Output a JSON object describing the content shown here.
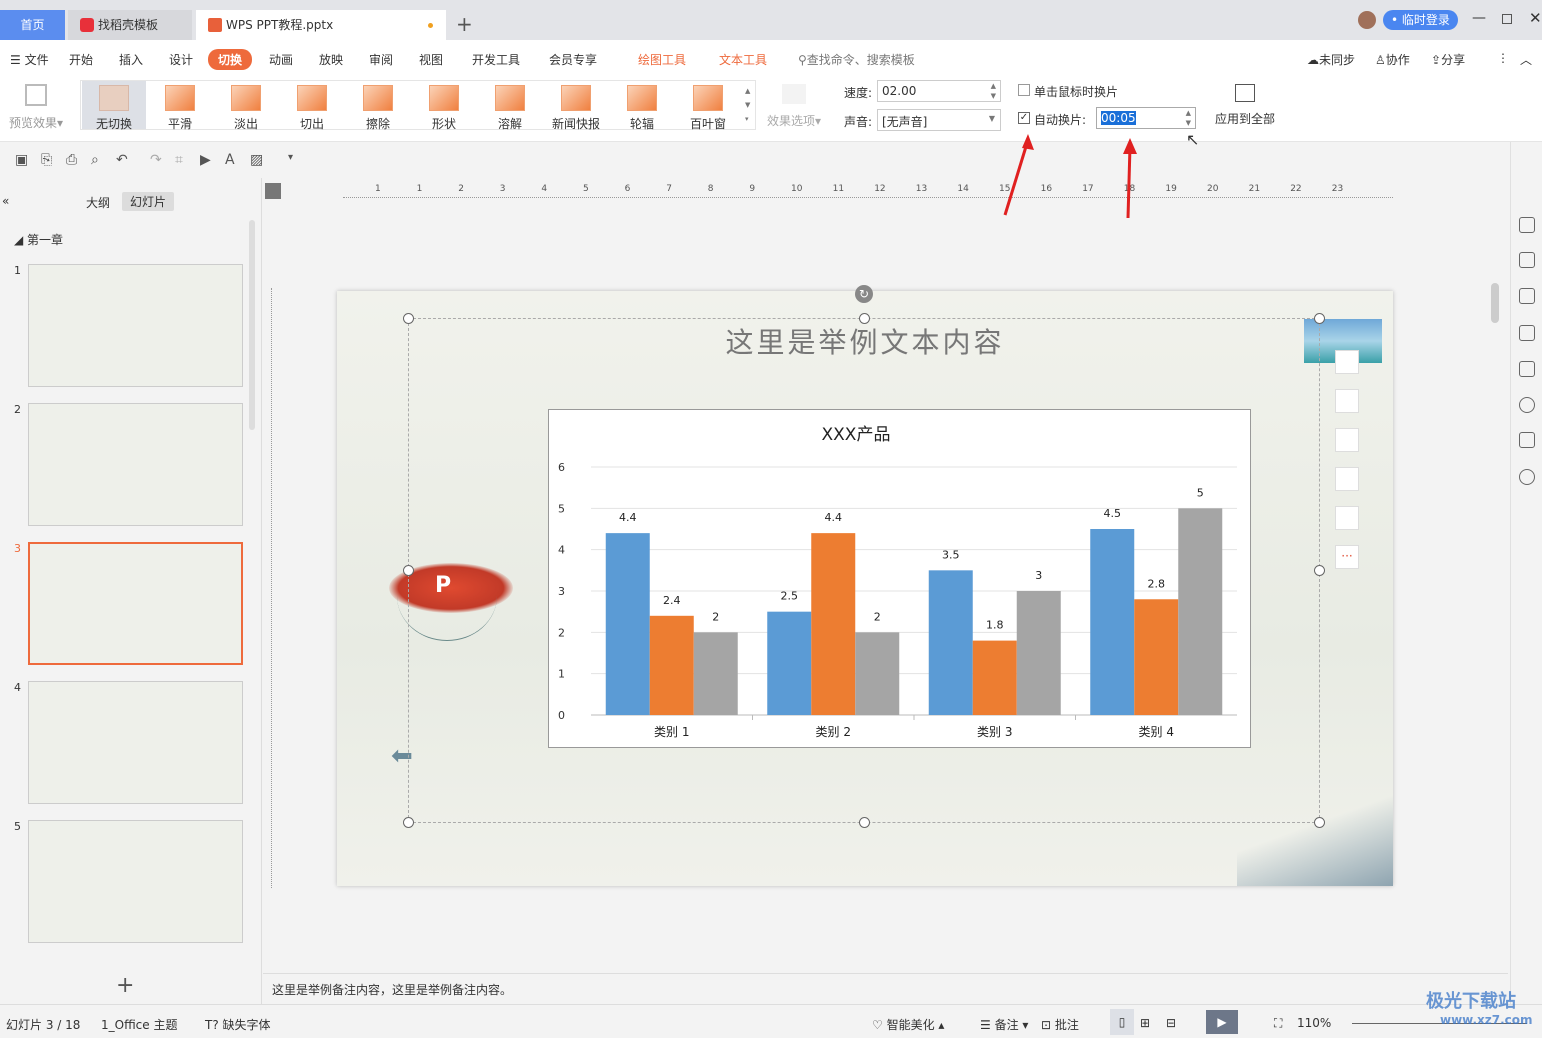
{
  "tabs": [
    {
      "label": "首页"
    },
    {
      "label": "找稻壳模板"
    },
    {
      "label": "WPS PPT教程.pptx"
    }
  ],
  "window": {
    "login": "• 临时登录"
  },
  "menu": {
    "items": [
      "文件",
      "开始",
      "插入",
      "设计",
      "切换",
      "动画",
      "放映",
      "审阅",
      "视图",
      "开发工具",
      "会员专享"
    ],
    "tool_items": [
      "绘图工具",
      "文本工具"
    ],
    "search": "查找命令、搜索模板",
    "sync": "未同步",
    "collab": "协作",
    "share": "分享"
  },
  "ribbon": {
    "preview": "预览效果",
    "transitions": [
      "无切换",
      "平滑",
      "淡出",
      "切出",
      "擦除",
      "形状",
      "溶解",
      "新闻快报",
      "轮辐",
      "百叶窗"
    ],
    "effect_options": "效果选项",
    "speed_label": "速度:",
    "speed_value": "02.00",
    "sound_label": "声音:",
    "sound_value": "[无声音]",
    "on_click_label": "单击鼠标时换片",
    "on_click_checked": false,
    "auto_label": "自动换片:",
    "auto_checked": true,
    "auto_value": "00:05",
    "apply_all": "应用到全部"
  },
  "panel": {
    "tab_outline": "大纲",
    "tab_slides": "幻灯片",
    "section": "第一章",
    "slides": [
      "1",
      "2",
      "3",
      "4",
      "5"
    ],
    "selected": 3,
    "add": "+"
  },
  "ruler": {
    "h_ticks": [
      "1",
      "1",
      "2",
      "3",
      "4",
      "5",
      "6",
      "7",
      "8",
      "9",
      "10",
      "11",
      "12",
      "13",
      "14",
      "15",
      "16",
      "17",
      "18",
      "19",
      "20",
      "21",
      "22",
      "23"
    ]
  },
  "slide": {
    "title": "这里是举例文本内容"
  },
  "chart_data": {
    "type": "bar",
    "title": "XXX产品",
    "categories": [
      "类别 1",
      "类别 2",
      "类别 3",
      "类别 4"
    ],
    "series": [
      {
        "values": [
          4.4,
          2.5,
          3.5,
          4.5
        ],
        "color": "#5b9bd5"
      },
      {
        "values": [
          2.4,
          4.4,
          1.8,
          2.8
        ],
        "color": "#ed7d31"
      },
      {
        "values": [
          2,
          2,
          3,
          5
        ],
        "color": "#a5a5a5"
      }
    ],
    "ylim": [
      0,
      6
    ],
    "yticks": [
      "0",
      "1",
      "2",
      "3",
      "4",
      "5",
      "6"
    ],
    "grid": true,
    "data_labels": true
  },
  "notes": "这里是举例备注内容，这里是举例备注内容。",
  "status": {
    "slide": "幻灯片 3 / 18",
    "theme": "1_Office 主题",
    "font": "缺失字体",
    "beautify": "智能美化",
    "notes": "备注",
    "comments": "批注",
    "zoom": "110%"
  },
  "watermark": {
    "text": "极光下载站",
    "url": "www.xz7.com"
  },
  "colors": {
    "accent": "#ee6a3c",
    "selected_tab": "#5b8def",
    "annotation_arrow": "#e02020"
  }
}
